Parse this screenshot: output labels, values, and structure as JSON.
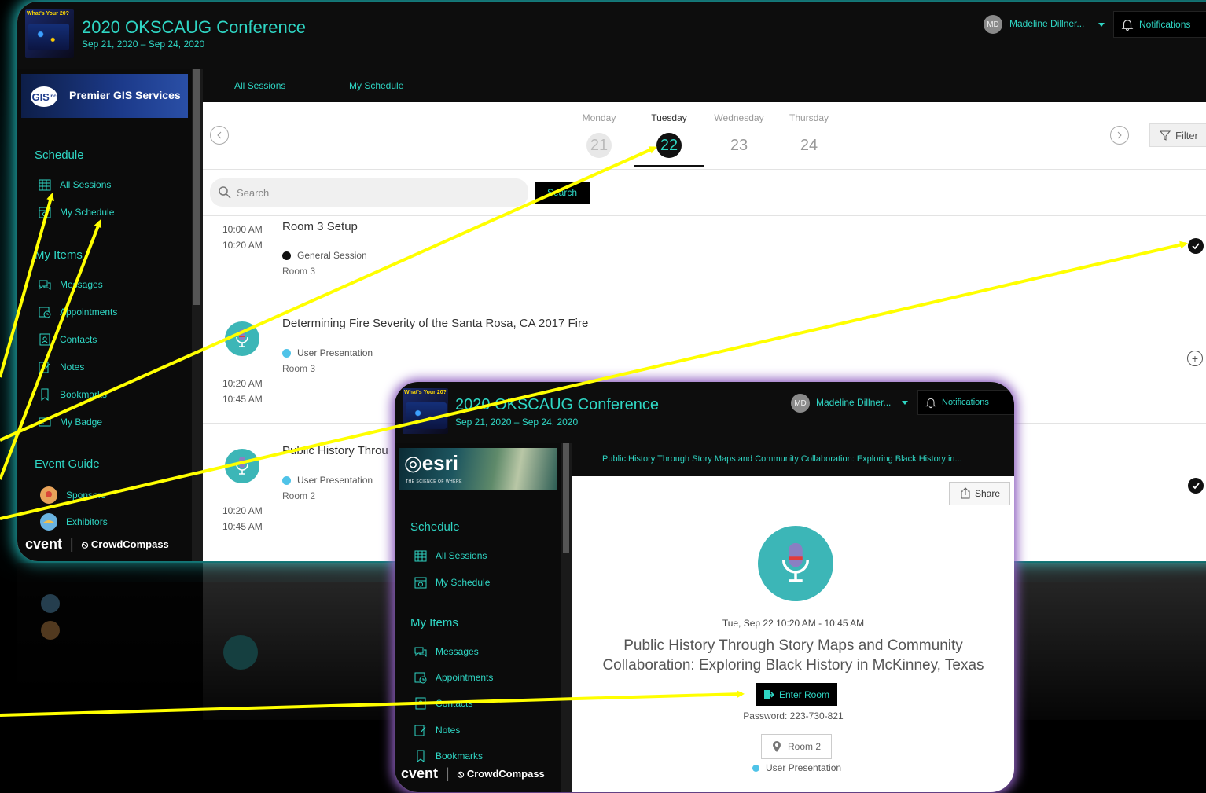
{
  "event": {
    "title": "2020 OKSCAUG Conference",
    "dates": "Sep 21, 2020 – Sep 24, 2020",
    "logo_text": "What's Your 20?"
  },
  "user": {
    "initials": "MD",
    "name": "Madeline Dillner..."
  },
  "notifications_label": "Notifications",
  "sponsor_banner": {
    "initials": "GIS",
    "suffix": "inc",
    "text": "Premier GIS Services"
  },
  "sidebar": {
    "schedule_heading": "Schedule",
    "schedule_items": [
      {
        "label": "All Sessions",
        "icon": "calendar-grid-icon"
      },
      {
        "label": "My Schedule",
        "icon": "calendar-star-icon"
      }
    ],
    "my_items_heading": "My Items",
    "my_items": [
      {
        "label": "Messages",
        "icon": "chat-icon"
      },
      {
        "label": "Appointments",
        "icon": "calendar-clock-icon"
      },
      {
        "label": "Contacts",
        "icon": "contact-card-icon"
      },
      {
        "label": "Notes",
        "icon": "note-pen-icon"
      },
      {
        "label": "Bookmarks",
        "icon": "bookmark-icon"
      },
      {
        "label": "My Badge",
        "icon": "badge-icon"
      }
    ],
    "event_guide_heading": "Event Guide",
    "event_guide_items": [
      {
        "label": "Sponsors",
        "icon": "sponsor-icon"
      },
      {
        "label": "Exhibitors",
        "icon": "exhibitor-icon"
      }
    ],
    "footer": {
      "cvent": "cvent",
      "crowdcompass": "CrowdCompass"
    }
  },
  "tabs": [
    "All Sessions",
    "My Schedule"
  ],
  "days": [
    {
      "name": "Monday",
      "num": "21",
      "state": "past"
    },
    {
      "name": "Tuesday",
      "num": "22",
      "state": "selected"
    },
    {
      "name": "Wednesday",
      "num": "23",
      "state": "future"
    },
    {
      "name": "Thursday",
      "num": "24",
      "state": "future"
    }
  ],
  "filter_label": "Filter",
  "search": {
    "placeholder": "Search",
    "button": "Search"
  },
  "sessions": [
    {
      "start": "10:00 AM",
      "end": "10:20 AM",
      "title": "Room 3 Setup",
      "type": "General Session",
      "type_color": "#111111",
      "room": "Room 3",
      "status": "added"
    },
    {
      "start": "10:20 AM",
      "end": "10:45 AM",
      "title": "Determining Fire Severity of the Santa Rosa, CA 2017 Fire",
      "type": "User Presentation",
      "type_color": "#4fc3e8",
      "room": "Room 3",
      "status": "add"
    },
    {
      "start": "10:20 AM",
      "end": "10:45 AM",
      "title": "Public History Throu",
      "type": "User Presentation",
      "type_color": "#4fc3e8",
      "room": "Room 2",
      "status": "added"
    }
  ],
  "popup": {
    "header_title": "Public History Through Story Maps and Community Collaboration: Exploring Black History in...",
    "share_label": "Share",
    "datetime": "Tue, Sep 22 10:20 AM - 10:45 AM",
    "title_line1": "Public History Through Story Maps and Community",
    "title_line2": "Collaboration: Exploring Black History in McKinney, Texas",
    "enter_label": "Enter Room",
    "password": "Password: 223-730-821",
    "room": "Room 2",
    "type": "User Presentation",
    "sponsor": {
      "name": "esri",
      "tagline": "THE SCIENCE OF WHERE"
    },
    "sidebar": {
      "schedule_heading": "Schedule",
      "schedule_items": [
        "All Sessions",
        "My Schedule"
      ],
      "my_items_heading": "My Items",
      "my_items": [
        "Messages",
        "Appointments",
        "Contacts",
        "Notes",
        "Bookmarks"
      ]
    }
  },
  "colors": {
    "accent": "#2fd6c4",
    "arrow": "#ffff00",
    "popup_glow": "#8e5fc0",
    "window_glow": "#1fb3b3"
  }
}
